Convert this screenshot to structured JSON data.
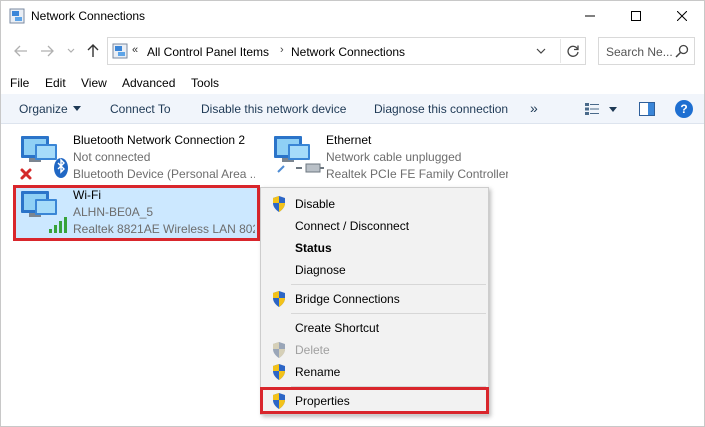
{
  "window": {
    "title": "Network Connections"
  },
  "address": {
    "overflow": "«",
    "crumbs": [
      "All Control Panel Items",
      "Network Connections"
    ],
    "chevron": "›"
  },
  "search": {
    "placeholder": "Search Ne..."
  },
  "menu": [
    "File",
    "Edit",
    "View",
    "Advanced",
    "Tools"
  ],
  "commands": {
    "organize": "Organize",
    "connect_to": "Connect To",
    "disable": "Disable this network device",
    "diagnose": "Diagnose this connection",
    "more": "»",
    "help": "?"
  },
  "connections": [
    {
      "name": "Bluetooth Network Connection 2",
      "status": "Not connected",
      "device": "Bluetooth Device (Personal Area ..."
    },
    {
      "name": "Ethernet",
      "status": "Network cable unplugged",
      "device": "Realtek PCIe FE Family Controller"
    },
    {
      "name": "Wi-Fi",
      "status": "ALHN-BE0A_5",
      "device": "Realtek 8821AE Wireless LAN 802...."
    }
  ],
  "context_menu": {
    "items": [
      {
        "label": "Disable",
        "shield": true,
        "bold": false,
        "disabled": false
      },
      {
        "label": "Connect / Disconnect",
        "shield": false,
        "bold": false,
        "disabled": false
      },
      {
        "label": "Status",
        "shield": false,
        "bold": true,
        "disabled": false
      },
      {
        "label": "Diagnose",
        "shield": false,
        "bold": false,
        "disabled": false
      },
      {
        "label": "Bridge Connections",
        "shield": true,
        "bold": false,
        "disabled": false
      },
      {
        "label": "Create Shortcut",
        "shield": false,
        "bold": false,
        "disabled": false
      },
      {
        "label": "Delete",
        "shield": true,
        "bold": false,
        "disabled": true
      },
      {
        "label": "Rename",
        "shield": true,
        "bold": false,
        "disabled": false
      },
      {
        "label": "Properties",
        "shield": true,
        "bold": false,
        "disabled": false
      }
    ]
  },
  "colors": {
    "highlight": "#d9262c",
    "selection": "#cce8ff",
    "command_bar": "#f1f5fb",
    "command_text": "#1e3955"
  }
}
